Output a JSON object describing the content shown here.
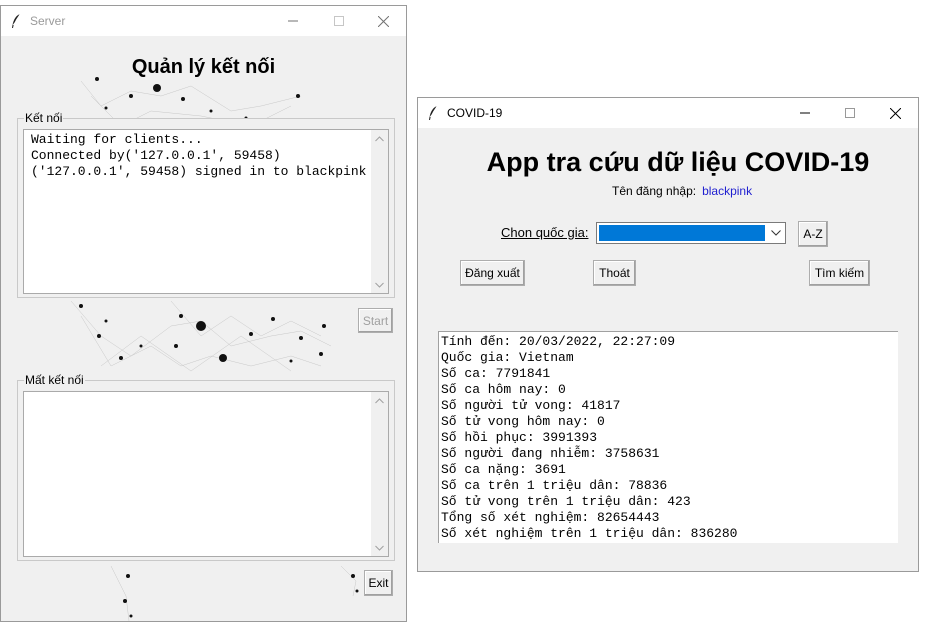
{
  "server_window": {
    "title": "Server",
    "heading": "Quản lý kết nối",
    "connected_group": {
      "legend": "Kết nối",
      "lines": [
        "Waiting for clients...",
        "Connected by('127.0.0.1', 59458)",
        "('127.0.0.1', 59458) signed in to blackpink"
      ]
    },
    "start_button": "Start",
    "disconnected_group": {
      "legend": "Mất kết nối",
      "lines": []
    },
    "exit_button": "Exit"
  },
  "covid_window": {
    "title": "COVID-19",
    "heading": "App tra cứu dữ liệu COVID-19",
    "login_label": "Tên đăng nhập:",
    "username": "blackpink",
    "country_label": "Chon quốc gia:",
    "country_value": "",
    "sort_button": "A-Z",
    "logout_button": "Đăng xuất",
    "quit_button": "Thoát",
    "search_button": "Tìm kiếm",
    "result_lines": [
      "Tính đến: 20/03/2022, 22:27:09",
      "Quốc gia: Vietnam",
      "Số ca: 7791841",
      "Số ca hôm nay: 0",
      "Số người tử vong: 41817",
      "Số tử vong hôm nay: 0",
      "Số hồi phục: 3991393",
      "Số người đang nhiễm: 3758631",
      "Số ca nặng: 3691",
      "Số ca trên 1 triệu dân: 78836",
      "Số tử vong trên 1 triệu dân: 423",
      "Tổng số xét nghiệm: 82654443",
      "Số xét nghiệm trên 1 triệu dân: 836280"
    ]
  },
  "colors": {
    "selection_blue": "#0078d7",
    "username_blue": "#1f1fd0",
    "window_bg": "#f0f0f0"
  },
  "icons": [
    "feather-icon",
    "minimize-icon",
    "maximize-icon",
    "close-icon",
    "chevron-down-icon",
    "chevron-up-icon"
  ]
}
